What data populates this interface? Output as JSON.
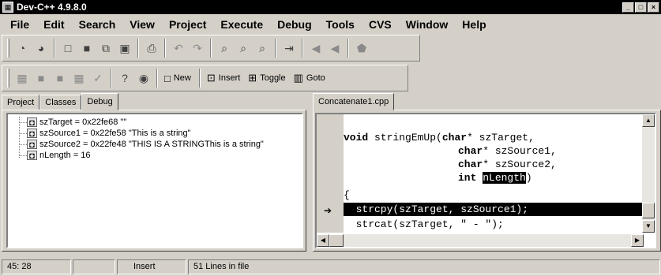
{
  "window": {
    "title": "Dev-C++ 4.9.8.0",
    "controls": [
      "_",
      "□",
      "×"
    ]
  },
  "menu": [
    {
      "label": "File"
    },
    {
      "label": "Edit"
    },
    {
      "label": "Search"
    },
    {
      "label": "View"
    },
    {
      "label": "Project"
    },
    {
      "label": "Execute"
    },
    {
      "label": "Debug"
    },
    {
      "label": "Tools"
    },
    {
      "label": "CVS"
    },
    {
      "label": "Window"
    },
    {
      "label": "Help"
    }
  ],
  "toolbar2": {
    "new_label": "New",
    "insert_label": "Insert",
    "toggle_label": "Toggle",
    "goto_label": "Goto"
  },
  "left_tabs": [
    "Project",
    "Classes",
    "Debug"
  ],
  "debug_vars": [
    "szTarget = 0x22fe68 \"\"",
    "szSource1 = 0x22fe58 \"This is a string\"",
    "szSource2 = 0x22fe48 \"THIS IS A STRINGThis is a string\"",
    "nLength = 16"
  ],
  "editor": {
    "file_tab": "Concatenate1.cpp",
    "lines": {
      "l1_kw": "void",
      "l1_rest": " stringEmUp(",
      "l1_kw2": "char",
      "l1_end": "* szTarget,",
      "l2_kw": "char",
      "l2_end": "* szSource1,",
      "l3_kw": "char",
      "l3_end": "* szSource2,",
      "l4_kw": "int",
      "l4_sel": "nLength",
      "l4_end": ")",
      "l5": "{",
      "l6": "  strcpy(szTarget, szSource1);",
      "l7": "  strcat(szTarget, \" - \");"
    }
  },
  "status": {
    "position": "45: 28",
    "mode": "Insert",
    "lines": "51 Lines in file"
  }
}
